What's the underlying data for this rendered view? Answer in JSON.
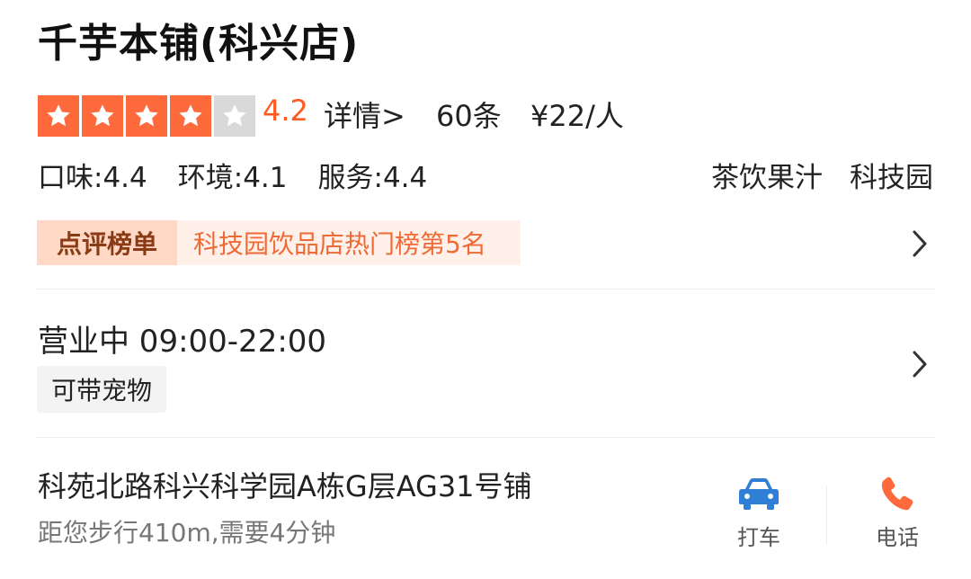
{
  "shop": {
    "name": "千芋本铺(科兴店)",
    "rating": {
      "stars_filled": 4,
      "stars_total": 5,
      "score": "4.2"
    },
    "detail_link": "详情>",
    "review_count": "60条",
    "price": "¥22/人",
    "scores": [
      {
        "label": "口味:4.4"
      },
      {
        "label": "环境:4.1"
      },
      {
        "label": "服务:4.4"
      }
    ],
    "category": "茶饮果汁",
    "area": "科技园"
  },
  "ranking": {
    "badge": "点评榜单",
    "text": "科技园饮品店热门榜第5名"
  },
  "hours": {
    "text": "营业中 09:00-22:00",
    "tag": "可带宠物"
  },
  "location": {
    "address": "科苑北路科兴科学园A栋G层AG31号铺",
    "distance": "距您步行410m,需要4分钟"
  },
  "actions": {
    "taxi_label": "打车",
    "call_label": "电话"
  },
  "colors": {
    "accent": "#ff6a3d",
    "star_off": "#d9d9d9",
    "rank_text": "#ef6a35",
    "taxi_icon": "#2f7fd6",
    "call_icon": "#ff6a3d"
  }
}
